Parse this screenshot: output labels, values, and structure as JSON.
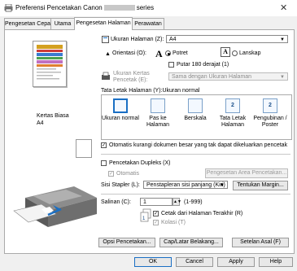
{
  "window": {
    "title_prefix": "Preferensi Pencetakan Canon",
    "title_suffix": "series",
    "close_glyph": "✕"
  },
  "tabs": [
    {
      "label": "Pengesetan Cepat"
    },
    {
      "label": "Utama"
    },
    {
      "label": "Pengesetan Halaman"
    },
    {
      "label": "Perawatan"
    }
  ],
  "page_size": {
    "label": "Ukuran Halaman (Z):",
    "value": "A4"
  },
  "orientation": {
    "label": "Orientasi (O):",
    "portrait": "Potret",
    "landscape": "Lanskap",
    "selected": "portrait",
    "rotate_label": "Putar 180 derajat (1)",
    "rotate_checked": false
  },
  "paper_size": {
    "label_line1": "Ukuran Kertas",
    "label_line2": "Pencetak (E):",
    "value": "Sama dengan Ukuran Halaman"
  },
  "preview": {
    "media_line1": "Kertas Biasa",
    "media_line2": "A4"
  },
  "layout": {
    "label": "Tata Letak Halaman (Y):Ukuran normal",
    "items": [
      {
        "label": "Ukuran normal",
        "icon": "",
        "selected": true
      },
      {
        "label": "Pas ke Halaman",
        "icon": "",
        "selected": false
      },
      {
        "label": "Berskala",
        "icon": "",
        "selected": false
      },
      {
        "label": "Tata Letak Halaman",
        "icon": "2",
        "selected": false
      },
      {
        "label": "Pengubinan / Poster",
        "icon": "2",
        "selected": false
      }
    ]
  },
  "auto_reduce": {
    "label": "Otomatis kurangi dokumen besar yang tak dapat dikeluarkan pencetak",
    "checked": true
  },
  "duplex": {
    "label": "Pencetakan Dupleks (X)",
    "checked": false,
    "auto_label": "Otomatis",
    "area_button": "Pengesetan Area Pencetakan..."
  },
  "stapling": {
    "label": "Sisi Stapler (L):",
    "value": "Penstapleran sisi panjang (Kiri)",
    "margin_button": "Tentukan Margin..."
  },
  "copies": {
    "label": "Salinan (C):",
    "value": "1",
    "range": "(1-999)",
    "last_page_label": "Cetak dari Halaman Terakhir (R)",
    "last_page_checked": true,
    "collate_label": "Kolasi (T)",
    "collate_checked": true
  },
  "buttons": {
    "print_options": "Opsi Pencetakan...",
    "stamp": "Cap/Latar Belakang...",
    "defaults": "Setelan Asal (F)"
  },
  "dialog": {
    "ok": "OK",
    "cancel": "Cancel",
    "apply": "Apply",
    "help": "Help"
  }
}
